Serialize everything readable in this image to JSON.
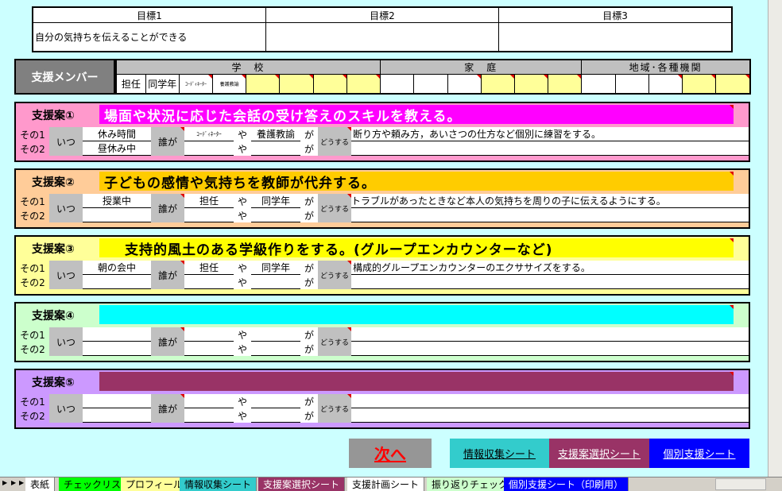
{
  "goals": {
    "headers": [
      "目標1",
      "目標2",
      "目標3"
    ],
    "values": [
      "自分の気持ちを伝えることができる",
      "",
      ""
    ]
  },
  "members": {
    "label": "支援メンバー",
    "groups": [
      "学　校",
      "家　庭",
      "地域･各種機関"
    ],
    "school_roles": [
      "担任",
      "同学年",
      "ｺｰﾃﾞｨﾈｰﾀｰ",
      "養護教諭"
    ]
  },
  "labels": {
    "sono1": "その1",
    "sono2": "その2",
    "itsu": "いつ",
    "darega": "誰が",
    "ya": "や",
    "ga": "が",
    "dousuru": "どうする"
  },
  "plans": [
    {
      "title": "支援案①",
      "banner": "場面や状況に応じた会話の受け答えのスキルを教える。",
      "when1": "休み時間",
      "when2": "昼休み中",
      "who1": "ｺｰﾃﾞｨﾈｰﾀｰ",
      "who2": "養護教諭",
      "action": "断り方や頼み方，あいさつの仕方など個別に練習をする。"
    },
    {
      "title": "支援案②",
      "banner": "子どもの感情や気持ちを教師が代弁する。",
      "when1": "授業中",
      "when2": "",
      "who1": "担任",
      "who2": "同学年",
      "action": "トラブルがあったときなど本人の気持ちを周りの子に伝えるようにする。"
    },
    {
      "title": "支援案③",
      "banner": "支持的風土のある学級作りをする。(グループエンカウンターなど)",
      "when1": "朝の会中",
      "when2": "",
      "who1": "担任",
      "who2": "同学年",
      "action": "構成的グループエンカウンターのエクササイズをする。"
    },
    {
      "title": "支援案④",
      "banner": "",
      "when1": "",
      "when2": "",
      "who1": "",
      "who2": "",
      "action": ""
    },
    {
      "title": "支援案⑤",
      "banner": "",
      "when1": "",
      "when2": "",
      "who1": "",
      "who2": "",
      "action": ""
    }
  ],
  "buttons": {
    "next": "次へ",
    "info": "情報収集シート",
    "select": "支援案選択シート",
    "individual": "個別支援シート"
  },
  "tabs": [
    "表紙",
    "チェックリスト",
    "プロフィール",
    "情報収集シート",
    "支援案選択シート",
    "支援計画シート",
    "振り返りチェック",
    "個別支援シート（印刷用）"
  ],
  "colors": {
    "page_bg": "#ccffff",
    "plan1_bg": "#ff99cc",
    "plan1_banner": "#ff00ff",
    "plan2_bg": "#ffcc99",
    "plan2_banner": "#ffcc00",
    "plan3_bg": "#ffff99",
    "plan3_banner": "#ffff00",
    "plan4_bg": "#ccffcc",
    "plan4_banner": "#00ffff",
    "plan5_bg": "#cc99ff",
    "plan5_banner": "#993366",
    "next_button": "#969696",
    "next_text": "#ff0000"
  }
}
